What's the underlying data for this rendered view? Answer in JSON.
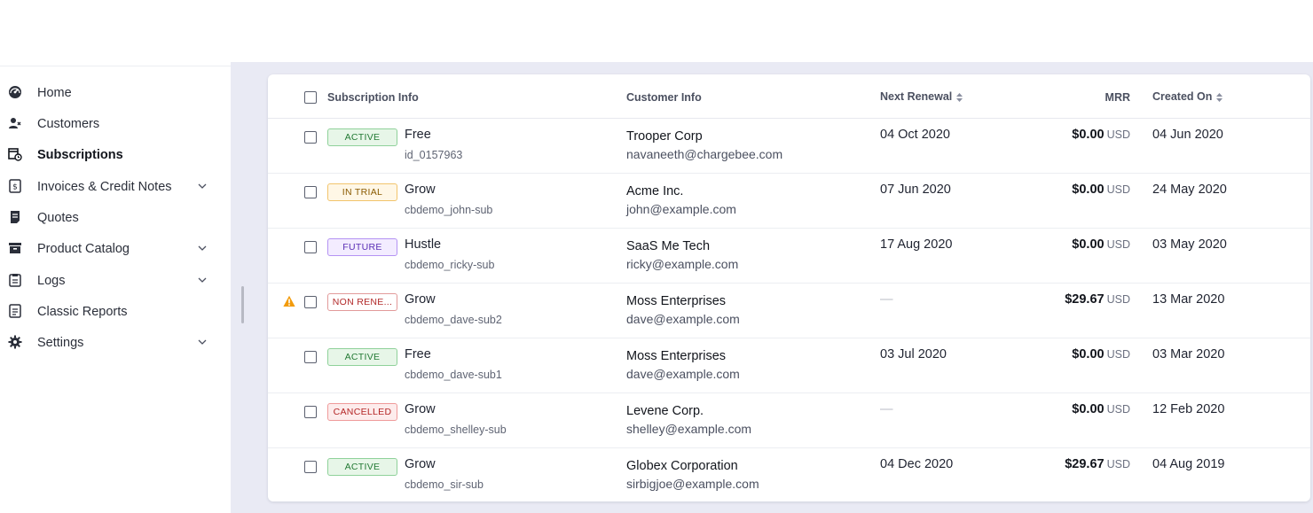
{
  "sidebar": {
    "items": [
      {
        "label": "Home",
        "icon": "dashboard-gauge-icon",
        "active": false,
        "expandable": false
      },
      {
        "label": "Customers",
        "icon": "users-icon",
        "active": false,
        "expandable": false
      },
      {
        "label": "Subscriptions",
        "icon": "calendar-clock-icon",
        "active": true,
        "expandable": false
      },
      {
        "label": "Invoices & Credit Notes",
        "icon": "invoice-icon",
        "active": false,
        "expandable": true
      },
      {
        "label": "Quotes",
        "icon": "quote-document-icon",
        "active": false,
        "expandable": false
      },
      {
        "label": "Product Catalog",
        "icon": "catalog-box-icon",
        "active": false,
        "expandable": true
      },
      {
        "label": "Logs",
        "icon": "clipboard-icon",
        "active": false,
        "expandable": true
      },
      {
        "label": "Classic Reports",
        "icon": "report-icon",
        "active": false,
        "expandable": false
      },
      {
        "label": "Settings",
        "icon": "gear-icon",
        "active": false,
        "expandable": true
      }
    ]
  },
  "table": {
    "headers": {
      "subscription_info": "Subscription Info",
      "customer_info": "Customer Info",
      "next_renewal": "Next Renewal",
      "mrr": "MRR",
      "created_on": "Created On"
    },
    "rows": [
      {
        "status": "ACTIVE",
        "status_kind": "active",
        "plan": "Free",
        "sub_id": "id_0157963",
        "customer": "Trooper Corp",
        "email": "navaneeth@chargebee.com",
        "next_renewal": "04 Oct 2020",
        "mrr": "$0.00",
        "currency": "USD",
        "created_on": "04 Jun 2020",
        "warning": false
      },
      {
        "status": "IN TRIAL",
        "status_kind": "trial",
        "plan": "Grow",
        "sub_id": "cbdemo_john-sub",
        "customer": "Acme Inc.",
        "email": "john@example.com",
        "next_renewal": "07 Jun 2020",
        "mrr": "$0.00",
        "currency": "USD",
        "created_on": "24 May 2020",
        "warning": false
      },
      {
        "status": "FUTURE",
        "status_kind": "future",
        "plan": "Hustle",
        "sub_id": "cbdemo_ricky-sub",
        "customer": "SaaS Me Tech",
        "email": "ricky@example.com",
        "next_renewal": "17 Aug 2020",
        "mrr": "$0.00",
        "currency": "USD",
        "created_on": "03 May 2020",
        "warning": false
      },
      {
        "status": "NON RENE...",
        "status_kind": "nonrenew",
        "plan": "Grow",
        "sub_id": "cbdemo_dave-sub2",
        "customer": "Moss Enterprises",
        "email": "dave@example.com",
        "next_renewal": "—",
        "mrr": "$29.67",
        "currency": "USD",
        "created_on": "13 Mar 2020",
        "warning": true
      },
      {
        "status": "ACTIVE",
        "status_kind": "active",
        "plan": "Free",
        "sub_id": "cbdemo_dave-sub1",
        "customer": "Moss Enterprises",
        "email": "dave@example.com",
        "next_renewal": "03 Jul 2020",
        "mrr": "$0.00",
        "currency": "USD",
        "created_on": "03 Mar 2020",
        "warning": false
      },
      {
        "status": "CANCELLED",
        "status_kind": "cancelled",
        "plan": "Grow",
        "sub_id": "cbdemo_shelley-sub",
        "customer": "Levene Corp.",
        "email": "shelley@example.com",
        "next_renewal": "—",
        "mrr": "$0.00",
        "currency": "USD",
        "created_on": "12 Feb 2020",
        "warning": false
      },
      {
        "status": "ACTIVE",
        "status_kind": "active",
        "plan": "Grow",
        "sub_id": "cbdemo_sir-sub",
        "customer": "Globex Corporation",
        "email": "sirbigjoe@example.com",
        "next_renewal": "04 Dec 2020",
        "mrr": "$29.67",
        "currency": "USD",
        "created_on": "04 Aug 2019",
        "warning": false
      }
    ]
  },
  "colors": {
    "main_bg": "#e9eaf4",
    "active_badge": "#237a34",
    "trial_badge": "#8a5a00",
    "future_badge": "#5a2fb5",
    "cancelled_badge": "#b42626",
    "warning": "#f29b0c"
  }
}
